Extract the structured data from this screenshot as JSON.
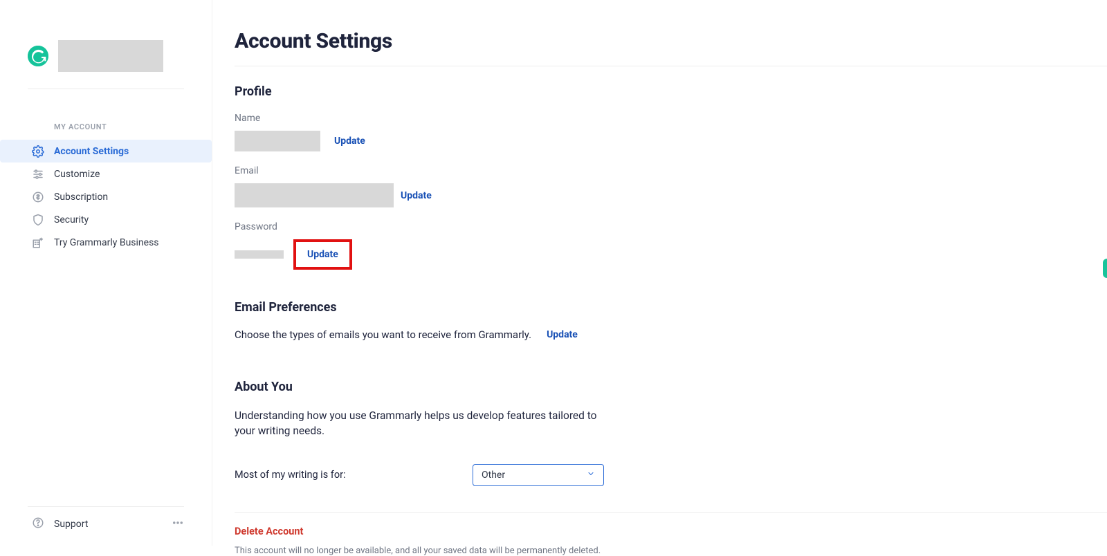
{
  "sidebar": {
    "section_label": "MY ACCOUNT",
    "items": [
      {
        "label": "Account Settings"
      },
      {
        "label": "Customize"
      },
      {
        "label": "Subscription"
      },
      {
        "label": "Security"
      },
      {
        "label": "Try Grammarly Business"
      }
    ],
    "support_label": "Support"
  },
  "page": {
    "title": "Account Settings"
  },
  "profile": {
    "heading": "Profile",
    "name_label": "Name",
    "name_update": "Update",
    "email_label": "Email",
    "email_update": "Update",
    "password_label": "Password",
    "password_update": "Update"
  },
  "email_prefs": {
    "heading": "Email Preferences",
    "desc": "Choose the types of emails you want to receive from Grammarly.",
    "update": "Update"
  },
  "about_you": {
    "heading": "About You",
    "desc": "Understanding how you use Grammarly helps us develop features tailored to your writing needs.",
    "question": "Most of my writing is for:",
    "selected": "Other"
  },
  "danger": {
    "heading": "Delete Account",
    "desc": "This account will no longer be available, and all your saved data will be permanently deleted."
  }
}
